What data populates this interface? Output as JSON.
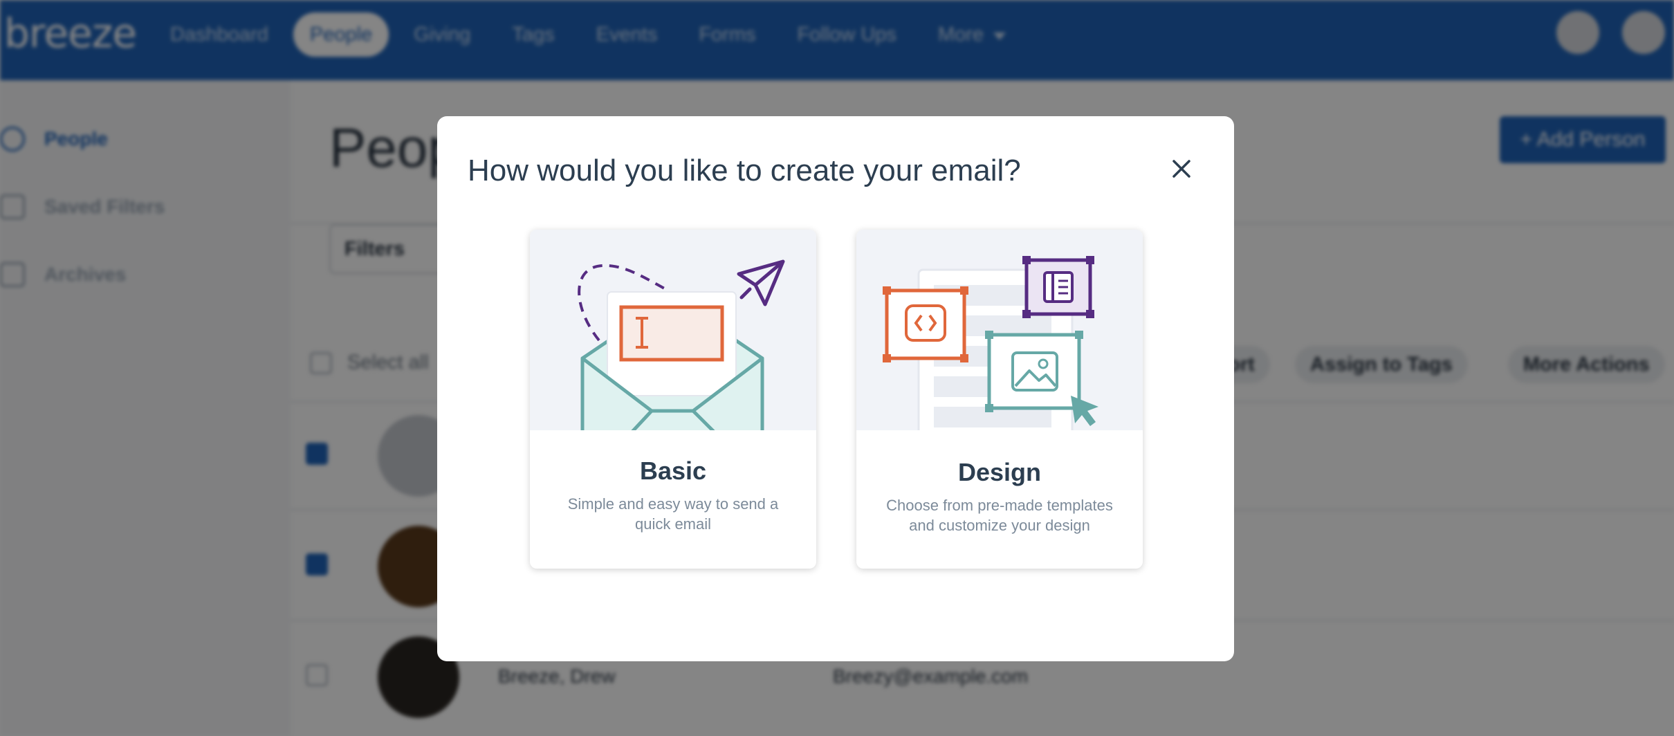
{
  "app": {
    "logo": "breeze",
    "nav": [
      {
        "label": "Dashboard"
      },
      {
        "label": "People"
      },
      {
        "label": "Giving"
      },
      {
        "label": "Tags"
      },
      {
        "label": "Events"
      },
      {
        "label": "Forms"
      },
      {
        "label": "Follow Ups"
      },
      {
        "label": "More"
      }
    ],
    "icons": {
      "search": "search-icon",
      "settings": "gear-icon"
    }
  },
  "sidebar": {
    "items": [
      {
        "label": "People"
      },
      {
        "label": "Saved Filters"
      },
      {
        "label": "Archives"
      }
    ]
  },
  "main": {
    "title": "People",
    "add_person_label": "+ Add Person",
    "filters_label": "Filters",
    "select_all_label": "Select all",
    "actions": {
      "export_label": "Export",
      "assign_tags_label": "Assign to Tags",
      "more_actions_label": "More Actions"
    },
    "rows": [
      {
        "name": "",
        "email": "",
        "checked": true
      },
      {
        "name": "",
        "email": "",
        "checked": true
      },
      {
        "name": "Breeze, Drew",
        "email": "Breezy@example.com",
        "checked": false
      }
    ]
  },
  "modal": {
    "title": "How would you like to create your email?",
    "options": [
      {
        "title": "Basic",
        "desc_line1": "Simple and easy way to send a",
        "desc_line2": "quick email"
      },
      {
        "title": "Design",
        "desc_line1": "Choose from pre-made templates",
        "desc_line2": "and customize your design"
      }
    ]
  },
  "colors": {
    "brand_blue": "#2063b8",
    "illus_orange": "#e0673b",
    "illus_teal": "#66a8a6",
    "illus_purple": "#562c82",
    "overlay": "rgba(0,0,0,0.48)"
  }
}
